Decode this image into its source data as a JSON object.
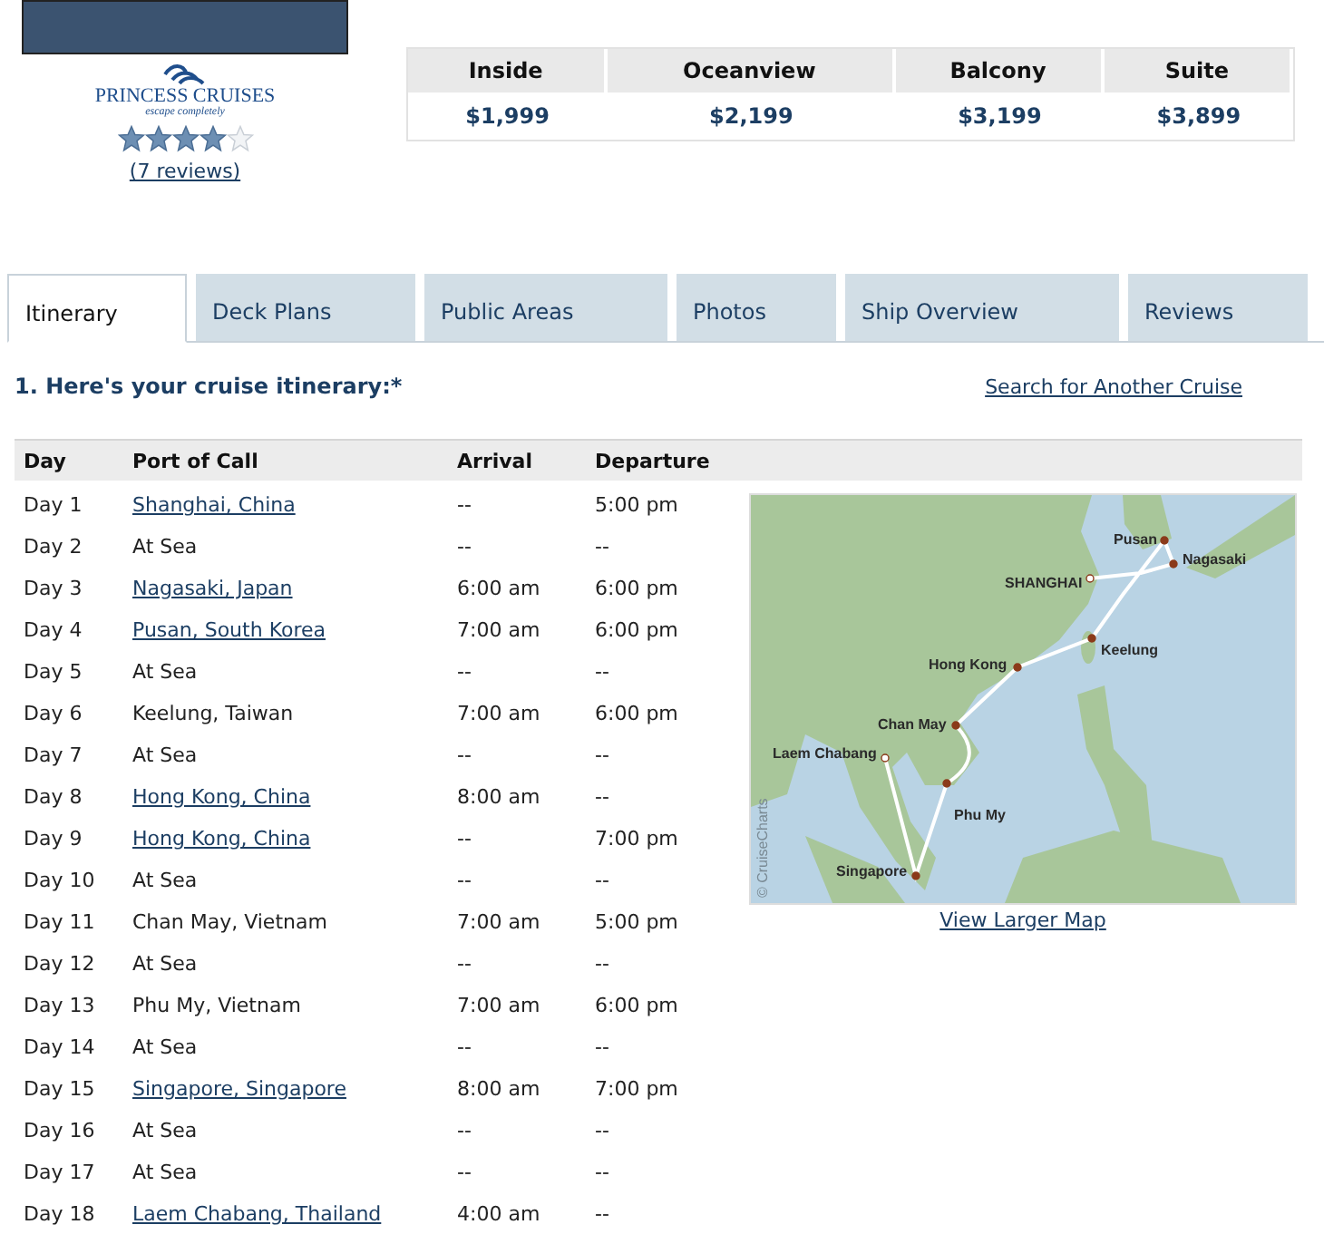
{
  "ship": {
    "brand": "PRINCESS CRUISES",
    "tagline": "escape completely",
    "stars": 4,
    "reviews_link": "(7 reviews)"
  },
  "prices": [
    {
      "category": "Inside",
      "price": "$1,999"
    },
    {
      "category": "Oceanview",
      "price": "$2,199"
    },
    {
      "category": "Balcony",
      "price": "$3,199"
    },
    {
      "category": "Suite",
      "price": "$3,899"
    }
  ],
  "tabs": [
    {
      "label": "Itinerary",
      "selected": true
    },
    {
      "label": "Deck Plans",
      "selected": false
    },
    {
      "label": "Public Areas",
      "selected": false
    },
    {
      "label": "Photos",
      "selected": false
    },
    {
      "label": "Ship Overview",
      "selected": false
    },
    {
      "label": "Reviews",
      "selected": false
    }
  ],
  "heading": "1. Here's your cruise itinerary:*",
  "search_link": "Search for Another Cruise",
  "table": {
    "columns": [
      "Day",
      "Port of Call",
      "Arrival",
      "Departure"
    ],
    "rows": [
      {
        "day": "Day 1",
        "port": "Shanghai, China",
        "link": true,
        "arrival": "--",
        "departure": "5:00 pm"
      },
      {
        "day": "Day 2",
        "port": "At Sea",
        "link": false,
        "arrival": "--",
        "departure": "--"
      },
      {
        "day": "Day 3",
        "port": "Nagasaki, Japan",
        "link": true,
        "arrival": "6:00 am",
        "departure": "6:00 pm"
      },
      {
        "day": "Day 4",
        "port": "Pusan, South Korea",
        "link": true,
        "arrival": "7:00 am",
        "departure": "6:00 pm"
      },
      {
        "day": "Day 5",
        "port": "At Sea",
        "link": false,
        "arrival": "--",
        "departure": "--"
      },
      {
        "day": "Day 6",
        "port": "Keelung, Taiwan",
        "link": false,
        "arrival": "7:00 am",
        "departure": "6:00 pm"
      },
      {
        "day": "Day 7",
        "port": "At Sea",
        "link": false,
        "arrival": "--",
        "departure": "--"
      },
      {
        "day": "Day 8",
        "port": "Hong Kong, China",
        "link": true,
        "arrival": "8:00 am",
        "departure": "--"
      },
      {
        "day": "Day 9",
        "port": "Hong Kong, China",
        "link": true,
        "arrival": "--",
        "departure": "7:00 pm"
      },
      {
        "day": "Day 10",
        "port": "At Sea",
        "link": false,
        "arrival": "--",
        "departure": "--"
      },
      {
        "day": "Day 11",
        "port": "Chan May, Vietnam",
        "link": false,
        "arrival": "7:00 am",
        "departure": "5:00 pm"
      },
      {
        "day": "Day 12",
        "port": "At Sea",
        "link": false,
        "arrival": "--",
        "departure": "--"
      },
      {
        "day": "Day 13",
        "port": "Phu My, Vietnam",
        "link": false,
        "arrival": "7:00 am",
        "departure": "6:00 pm"
      },
      {
        "day": "Day 14",
        "port": "At Sea",
        "link": false,
        "arrival": "--",
        "departure": "--"
      },
      {
        "day": "Day 15",
        "port": "Singapore, Singapore",
        "link": true,
        "arrival": "8:00 am",
        "departure": "7:00 pm"
      },
      {
        "day": "Day 16",
        "port": "At Sea",
        "link": false,
        "arrival": "--",
        "departure": "--"
      },
      {
        "day": "Day 17",
        "port": "At Sea",
        "link": false,
        "arrival": "--",
        "departure": "--"
      },
      {
        "day": "Day 18",
        "port": "Laem Chabang, Thailand",
        "link": true,
        "arrival": "4:00 am",
        "departure": "--"
      }
    ]
  },
  "map": {
    "labels": [
      "Pusan",
      "Nagasaki",
      "SHANGHAI",
      "Keelung",
      "Hong Kong",
      "Chan May",
      "Laem Chabang",
      "Phu My",
      "Singapore"
    ],
    "credit": "© CruiseCharts",
    "link": "View Larger Map"
  }
}
